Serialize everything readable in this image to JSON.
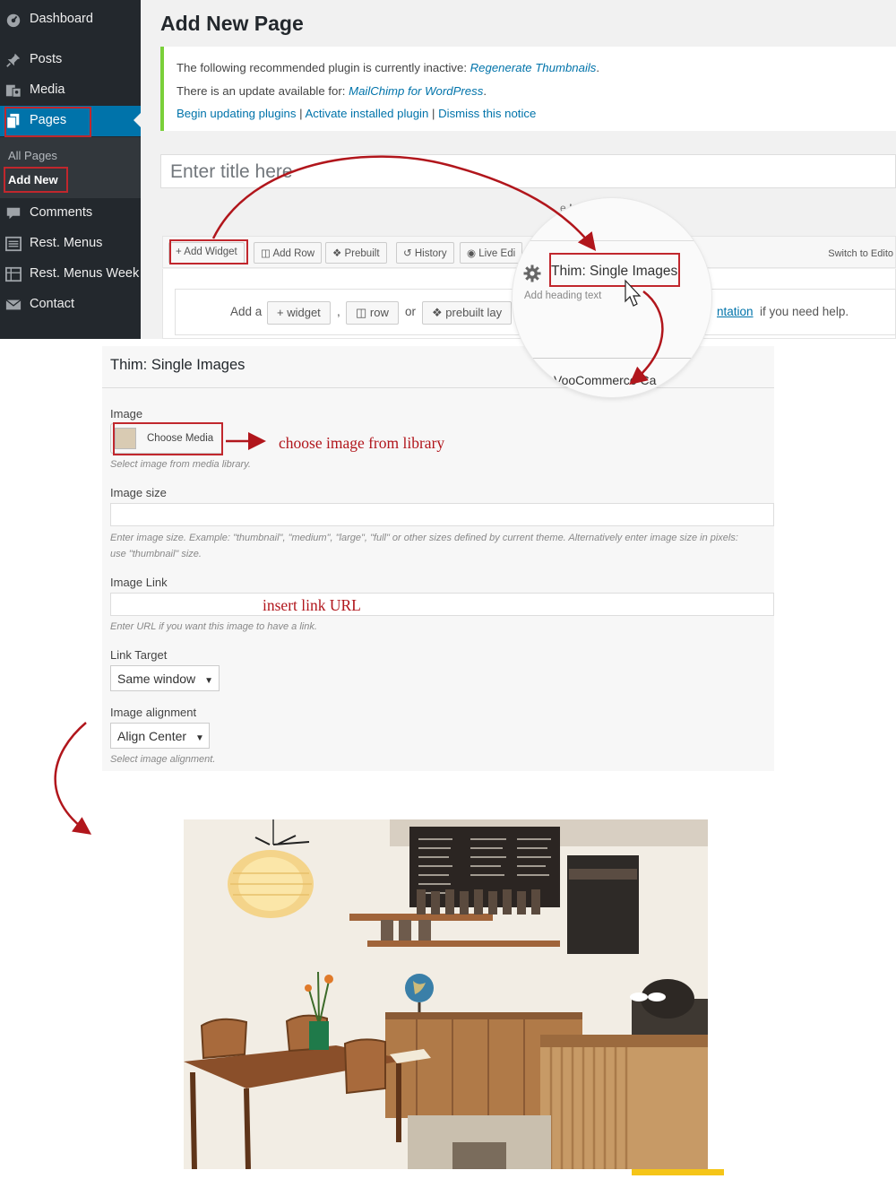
{
  "sidebar": {
    "items": [
      {
        "label": "Dashboard",
        "icon": "dashboard-icon"
      },
      {
        "label": "Posts",
        "icon": "pushpin-icon"
      },
      {
        "label": "Media",
        "icon": "media-icon"
      },
      {
        "label": "Pages",
        "icon": "pages-icon",
        "active": true
      },
      {
        "label": "Comments",
        "icon": "comment-icon"
      },
      {
        "label": "Rest. Menus",
        "icon": "list-icon"
      },
      {
        "label": "Rest. Menus Week",
        "icon": "calendar-grid-icon"
      },
      {
        "label": "Contact",
        "icon": "envelope-icon"
      }
    ],
    "submenu": [
      "All Pages",
      "Add New"
    ]
  },
  "page": {
    "title": "Add New Page",
    "title_placeholder": "Enter title here"
  },
  "notice": {
    "line1_text": "The following recommended plugin is currently inactive:",
    "line1_link": "Regenerate Thumbnails",
    "line2_text": "There is an update available for:",
    "line2_link": "MailChimp for WordPress",
    "actions": [
      "Begin updating plugins",
      "Activate installed plugin",
      "Dismiss this notice"
    ],
    "separator": "|"
  },
  "builder": {
    "maps_text": "e Maps widget.",
    "toolbar": [
      "Add Widget",
      "Add Row",
      "Prebuilt",
      "History",
      "Live Edi"
    ],
    "switch_label": "Switch to Edito",
    "empty_add": "Add a",
    "empty_widget": "widget",
    "empty_row": "row",
    "empty_or": "or",
    "empty_prebuilt": "prebuilt lay",
    "help_link": "ntation",
    "help_suffix": "if you need help."
  },
  "magnifier": {
    "widget_title": "Thim: Single Images",
    "widget_sub": "Add heading text",
    "next_widget": "VooCommerce Ca"
  },
  "form": {
    "title": "Thim: Single Images",
    "image_label": "Image",
    "choose_media": "Choose Media",
    "image_help": "Select image from media library.",
    "size_label": "Image size",
    "size_help1": "Enter image size. Example: \"thumbnail\", \"medium\", \"large\", \"full\" or other sizes defined by current theme. Alternatively enter image size in pixels:",
    "size_help2": "use \"thumbnail\" size.",
    "link_label": "Image Link",
    "link_help": "Enter URL if you want this image to have a link.",
    "target_label": "Link Target",
    "target_value": "Same window",
    "align_label": "Image alignment",
    "align_value": "Align Center",
    "align_help": "Select image alignment."
  },
  "annotations": {
    "choose": "choose image from library",
    "link": "insert link URL"
  },
  "colors": {
    "sidebar_bg": "#23282d",
    "active_blue": "#0073aa",
    "annotation_red": "#b1161c",
    "notice_green": "#7ad03a"
  }
}
